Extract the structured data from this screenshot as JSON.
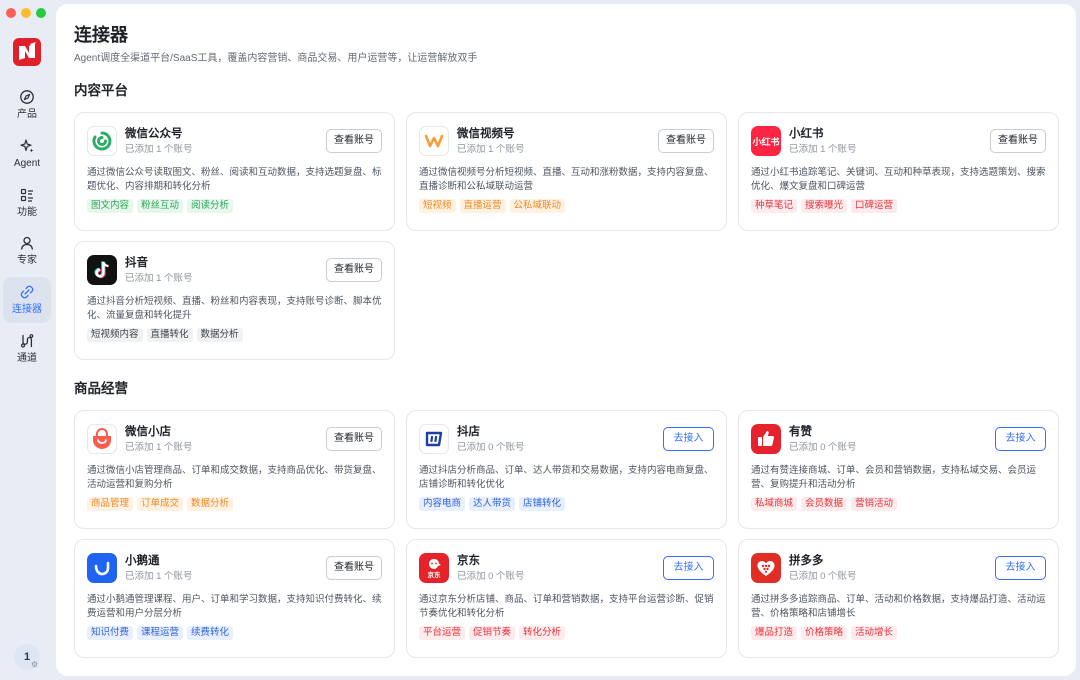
{
  "window": {
    "lights": [
      {
        "name": "close",
        "color": "#fe5f57"
      },
      {
        "name": "minimize",
        "color": "#febc2e"
      },
      {
        "name": "maximize",
        "color": "#28c840"
      }
    ]
  },
  "colors": {
    "accent": "#3370ff",
    "brand": "#e0202b",
    "sidebar_active": "#dce3ef"
  },
  "sidebar": {
    "logo_icon": "brand-logo-icon",
    "items": [
      {
        "label": "产品",
        "icon": "compass-icon",
        "active": false
      },
      {
        "label": "Agent",
        "icon": "sparkle-icon",
        "active": false
      },
      {
        "label": "功能",
        "icon": "list-icon",
        "active": false
      },
      {
        "label": "专家",
        "icon": "person-icon",
        "active": false
      },
      {
        "label": "连接器",
        "icon": "link-icon",
        "active": true
      },
      {
        "label": "通道",
        "icon": "channel-icon",
        "active": false
      }
    ],
    "avatar_label": "1",
    "avatar_gear": "⚙"
  },
  "header": {
    "title": "连接器",
    "subtitle": "Agent调度全渠道平台/SaaS工具，覆盖内容营销、商品交易、用户运营等，让运营解放双手"
  },
  "sections": [
    {
      "title": "内容平台",
      "cards": [
        {
          "name": "微信公众号",
          "count": "已添加 1 个账号",
          "button": "查看账号",
          "button_type": "view",
          "icon": "wechat-official-icon",
          "desc": "通过微信公众号读取图文、粉丝、阅读和互动数据，支持选题复盘、标题优化、内容排期和转化分析",
          "tag_color": "green",
          "tags": [
            "图文内容",
            "粉丝互动",
            "阅读分析"
          ]
        },
        {
          "name": "微信视频号",
          "count": "已添加 1 个账号",
          "button": "查看账号",
          "button_type": "view",
          "icon": "wechat-channels-icon",
          "desc": "通过微信视频号分析短视频、直播、互动和涨粉数据，支持内容复盘、直播诊断和公私域联动运营",
          "tag_color": "orange",
          "tags": [
            "短视频",
            "直播运营",
            "公私域联动"
          ]
        },
        {
          "name": "小红书",
          "count": "已添加 1 个账号",
          "button": "查看账号",
          "button_type": "view",
          "icon": "xiaohongshu-icon",
          "icon_text": "小红书",
          "desc": "通过小红书追踪笔记、关键词、互动和种草表现，支持选题策划、搜索优化、爆文复盘和口碑运营",
          "tag_color": "red",
          "tags": [
            "种草笔记",
            "搜索曝光",
            "口碑运营"
          ]
        },
        {
          "name": "抖音",
          "count": "已添加 1 个账号",
          "button": "查看账号",
          "button_type": "view",
          "icon": "douyin-icon",
          "desc": "通过抖音分析短视频、直播、粉丝和内容表现，支持账号诊断、脚本优化、流量复盘和转化提升",
          "tag_color": "gray",
          "tags": [
            "短视频内容",
            "直播转化",
            "数据分析"
          ]
        }
      ]
    },
    {
      "title": "商品经营",
      "cards": [
        {
          "name": "微信小店",
          "count": "已添加 1 个账号",
          "button": "查看账号",
          "button_type": "view",
          "icon": "wechat-store-icon",
          "desc": "通过微信小店管理商品、订单和成交数据，支持商品优化、带货复盘、活动运营和复购分析",
          "tag_color": "orange",
          "tags": [
            "商品管理",
            "订单成交",
            "数据分析"
          ]
        },
        {
          "name": "抖店",
          "count": "已添加 0 个账号",
          "button": "去接入",
          "button_type": "connect",
          "icon": "doudian-icon",
          "desc": "通过抖店分析商品、订单、达人带货和交易数据，支持内容电商复盘、店铺诊断和转化优化",
          "tag_color": "blue",
          "tags": [
            "内容电商",
            "达人带货",
            "店铺转化"
          ]
        },
        {
          "name": "有赞",
          "count": "已添加 0 个账号",
          "button": "去接入",
          "button_type": "connect",
          "icon": "youzan-icon",
          "desc": "通过有赞连接商城、订单、会员和营销数据，支持私域交易、会员运营、复购提升和活动分析",
          "tag_color": "red",
          "tags": [
            "私域商城",
            "会员数据",
            "营销活动"
          ]
        },
        {
          "name": "小鹅通",
          "count": "已添加 1 个账号",
          "button": "查看账号",
          "button_type": "view",
          "icon": "xiaoe-icon",
          "desc": "通过小鹅通管理课程、用户、订单和学习数据，支持知识付费转化、续费运营和用户分层分析",
          "tag_color": "blue",
          "tags": [
            "知识付费",
            "课程运营",
            "续费转化"
          ]
        },
        {
          "name": "京东",
          "count": "已添加 0 个账号",
          "button": "去接入",
          "button_type": "connect",
          "icon": "jd-icon",
          "icon_text": "京东",
          "desc": "通过京东分析店铺、商品、订单和营销数据，支持平台运营诊断、促销节奏优化和转化分析",
          "tag_color": "red",
          "tags": [
            "平台运营",
            "促销节奏",
            "转化分析"
          ]
        },
        {
          "name": "拼多多",
          "count": "已添加 0 个账号",
          "button": "去接入",
          "button_type": "connect",
          "icon": "pinduoduo-icon",
          "desc": "通过拼多多追踪商品、订单、活动和价格数据，支持爆品打造、活动运营、价格策略和店铺增长",
          "tag_color": "red",
          "tags": [
            "爆品打造",
            "价格策略",
            "活动增长"
          ]
        }
      ]
    }
  ]
}
